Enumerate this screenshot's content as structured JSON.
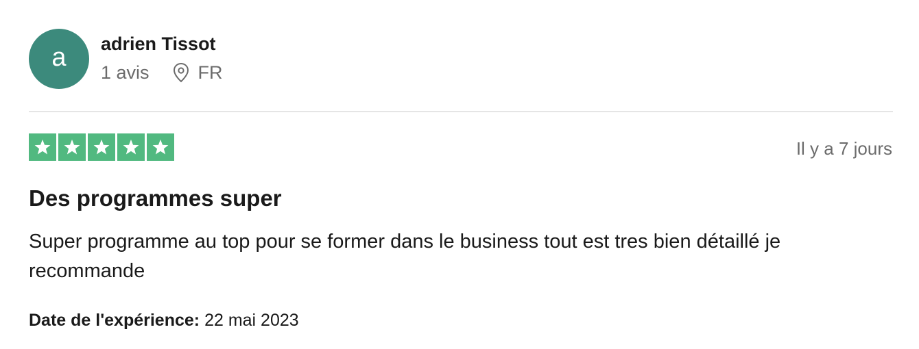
{
  "reviewer": {
    "avatar_initial": "a",
    "avatar_color": "#3c8a7c",
    "name": "adrien Tissot",
    "reviews_count": "1 avis",
    "country": "FR",
    "location_icon": "map-pin-icon"
  },
  "review": {
    "rating": 5,
    "rating_max": 5,
    "star_color": "#51b980",
    "star_icon": "star-icon",
    "date_relative": "Il y a 7 jours",
    "title": "Des programmes super",
    "body": "Super programme au top pour se former dans le business tout est tres bien détaillé je recommande",
    "experience_label": "Date de l'expérience:",
    "experience_date": "22 mai 2023"
  }
}
